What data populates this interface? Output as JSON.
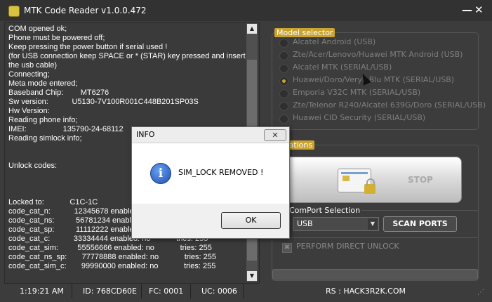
{
  "window": {
    "title": "MTK Code Reader v1.0.0.472",
    "minimize_label": "—",
    "close_label": "✕"
  },
  "log": {
    "text": "COM opened ok;\nPhone must be powered off;\nKeep pressing the power button if serial used !\n(for USB connection keep SPACE or * (STAR) key pressed and insert\nthe usb cable)\nConnecting;\nMeta mode entered;\nBaseband Chip:        MT6276\nSw version:           U5130-7V100R001C448B201SP03S\nHw Version:\nReading phone info;\nIMEI:                 135790-24-68112\nReading simlock info;\n\n\nUnlock codes:\n\n\n\nLocked to:            C1C-1C\ncode_cat_n:           12345678 enabled: no            tries: 255\ncode_cat_ns:          56781234 enabled: no            tries: 255\ncode_cat_sp:          11112222 enabled: no            tries: 255\ncode_cat_c:           33334444 enabled: no            tries: 255\ncode_cat_sim:         55556666 enabled: no            tries: 255\ncode_cat_ns_sp:       77778888 enabled: no            tries: 255\ncode_cat_sim_c:       99990000 enabled: no            tries: 255"
  },
  "model_selector": {
    "label": "Model selector",
    "options": [
      {
        "label": "Alcatel Android (USB)",
        "selected": false
      },
      {
        "label": "Zte/Acer/Lenovo/Huawei MTK Android (USB)",
        "selected": false
      },
      {
        "label": "Alcatel MTK (SERIAL/USB)",
        "selected": false
      },
      {
        "label": "Huawei/Doro/Veryk Blu MTK (SERIAL/USB)",
        "selected": true
      },
      {
        "label": "Emporia V32C MTK (SERIAL/USB)",
        "selected": false
      },
      {
        "label": "Zte/Telenor R240/Alcatel 639G/Doro (SERIAL/USB)",
        "selected": false
      },
      {
        "label": "Huawei CID Security (SERIAL/USB)",
        "selected": false
      }
    ]
  },
  "operations": {
    "label": "rations",
    "stop_label": "STOP",
    "comport_label": "ComPort Selection",
    "comport_value": "USB",
    "scan_label": "SCAN PORTS",
    "direct_unlock_label": "PERFORM DIRECT UNLOCK"
  },
  "status": {
    "time": "1:19:21 AM",
    "id": "ID: 768CD60E",
    "fc": "FC: 0001",
    "uc": "UC: 0006",
    "rs": "RS : HACK3R2K.COM"
  },
  "dialog": {
    "title": "INFO",
    "close_label": "✕",
    "icon_glyph": "i",
    "message": "SIM_LOCK REMOVED !",
    "ok_label": "OK"
  },
  "colors": {
    "accent": "#c9a431",
    "background": "#3c3c3c"
  },
  "icons": [
    "app-icon",
    "info-icon",
    "id-card-icon",
    "padlock-icon",
    "checkbox-icon",
    "cursor-icon"
  ]
}
